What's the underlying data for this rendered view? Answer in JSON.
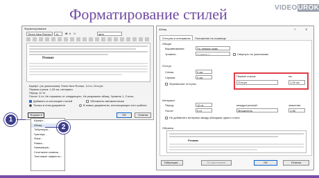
{
  "slide": {
    "title": "Форматирование стилей",
    "logo_a": "VIDEO",
    "logo_b": "UROKI"
  },
  "left": {
    "title": "Форматирование",
    "font_name": "Times New Roman",
    "font_size": "14",
    "lang": "авто",
    "preview_word": "Резюме",
    "desc1": "Шрифт: (по умолчанию) Times New Roman, 14 пт, Отступ:",
    "desc2": "Первая строка: 1,25 см, интервал",
    "desc3": "Перед: 12 пт",
    "desc4": "После: 0 пт, Не отрывать от следующего, Не разрывать абзац, Уровень 1, Стиль:",
    "chk_add": "Добавить в коллекцию стилей",
    "chk_auto": "Обновлять автоматически",
    "radio1": "Только в этом документе",
    "radio2": "В новых документах, использующих этот шаблон",
    "format_btn": "Формат ▾",
    "ok": "ОК",
    "cancel": "Отмена",
    "menu": [
      "Шрифт...",
      "Абзац...",
      "Табуляция...",
      "Граница...",
      "Язык...",
      "Рамка...",
      "Нумерация...",
      "Сочетание клавиш...",
      "Текстовые эффекты..."
    ]
  },
  "badges": {
    "one": "1",
    "two": "2"
  },
  "right": {
    "title": "Абзац",
    "help": "?",
    "close": "✕",
    "tab1": "Отступы и интервалы",
    "tab2": "Положение на странице",
    "g_general": "Общие",
    "align_label": "Выравнивание:",
    "align_val": "По левому краю",
    "level_label": "Уровень:",
    "level_val": "Уровень 1",
    "collapse": "Свернуто по умолчанию",
    "g_indent": "Отступ",
    "left_label": "Слева:",
    "left_val": "0 см",
    "right_label": "Справа:",
    "right_val": "0 см",
    "mirror": "Зеркальные отступы",
    "first_label": "Первая строка:",
    "first_val": "Отступ",
    "on_label": "на:",
    "on_val": "1,25 см",
    "g_spacing": "Интервал",
    "before_label": "Перед:",
    "before_val": "12 пт",
    "after_label": "После:",
    "after_val": "0 пт",
    "line_label": "междустрочный:",
    "line_val": "Множитель",
    "val_label": "значение:",
    "val_val": "1,08",
    "no_space": "Не добавлять интервал между абзацами одного стиля",
    "g_sample": "Образец",
    "sample_word": "Резюме",
    "tabs_btn": "Табуляция...",
    "default_btn": "По умолчанию",
    "ok": "ОК",
    "cancel": "Отмена"
  }
}
